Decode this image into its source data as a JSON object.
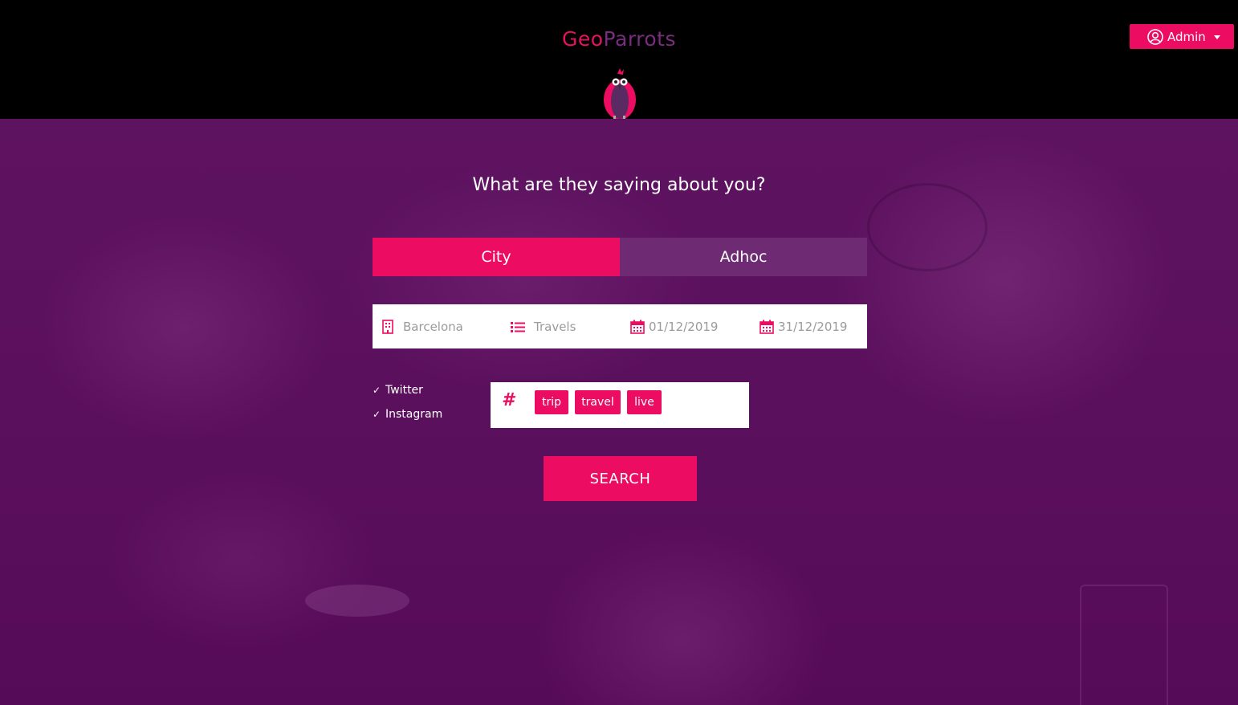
{
  "header": {
    "brand_geo": "Geo",
    "brand_parrots": "Parrots",
    "user_menu_label": "Admin"
  },
  "hero": {
    "headline": "What are they saying about you?"
  },
  "tabs": [
    {
      "label": "City",
      "active": true
    },
    {
      "label": "Adhoc",
      "active": false
    }
  ],
  "filters": {
    "city": {
      "icon": "building-icon",
      "value": "Barcelona"
    },
    "category": {
      "icon": "list-icon",
      "value": "Travels"
    },
    "start_date": {
      "icon": "calendar-icon",
      "value": "01/12/2019"
    },
    "end_date": {
      "icon": "calendar-icon",
      "value": "31/12/2019"
    }
  },
  "networks": [
    {
      "label": "Twitter",
      "checked": true
    },
    {
      "label": "Instagram",
      "checked": true
    }
  ],
  "hashtags": {
    "icon_glyph": "#",
    "tags": [
      "trip",
      "travel",
      "live"
    ]
  },
  "search_button_label": "SEARCH",
  "colors": {
    "accent": "#ec0c62",
    "brand_purple": "#7a2d7f",
    "background": "#5a0f5c",
    "topbar": "#000000"
  }
}
